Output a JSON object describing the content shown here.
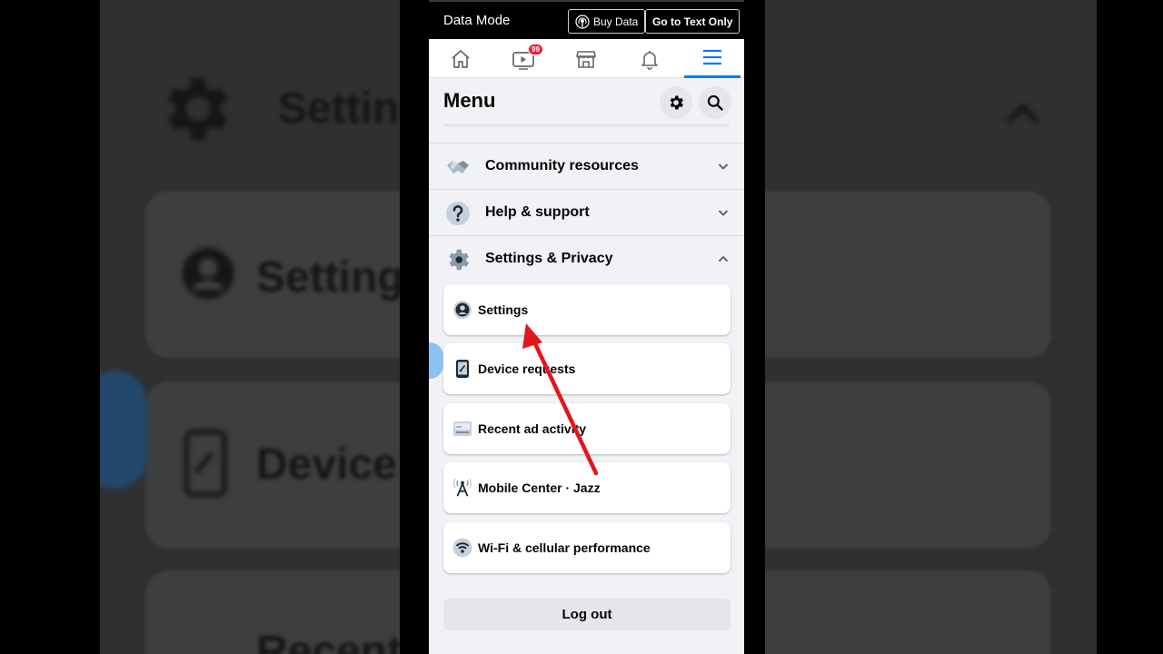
{
  "status_bar": {
    "title": "Data Mode",
    "buy_data_label": "Buy Data",
    "text_only_label": "Go to Text Only"
  },
  "nav": {
    "items": [
      "home-icon",
      "video-icon",
      "marketplace-icon",
      "bell-icon",
      "hamburger-menu-icon"
    ],
    "video_badge": "99",
    "active_index": 4
  },
  "menu": {
    "title": "Menu",
    "sections": [
      {
        "label": "Community resources",
        "icon": "handshake-icon",
        "expanded": false
      },
      {
        "label": "Help & support",
        "icon": "question-icon",
        "expanded": false
      },
      {
        "label": "Settings & Privacy",
        "icon": "gear-icon",
        "expanded": true
      }
    ],
    "settings_items": [
      {
        "label": "Settings",
        "icon": "user-circle-icon"
      },
      {
        "label": "Device requests",
        "icon": "phone-icon"
      },
      {
        "label": "Recent ad activity",
        "icon": "ad-activity-icon"
      },
      {
        "label": "Mobile Center · Jazz",
        "icon": "antenna-icon"
      },
      {
        "label": "Wi-Fi & cellular performance",
        "icon": "wifi-icon"
      }
    ],
    "logout_label": "Log out"
  },
  "background": {
    "texts": [
      "Settin",
      "Settings",
      "Device r",
      "Recent"
    ]
  },
  "colors": {
    "accent": "#1877f2",
    "badge": "#e41e3f",
    "arrow": "#e3161b",
    "page_bg": "#f0f2f5"
  }
}
